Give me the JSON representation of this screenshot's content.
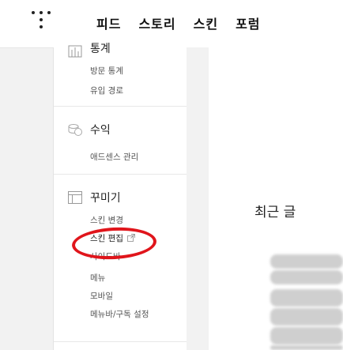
{
  "header": {
    "logo_icon": "tistory-dots-logo-icon",
    "nav": [
      "피드",
      "스토리",
      "스킨",
      "포럼"
    ]
  },
  "sidebar": {
    "stats_section": {
      "title": "통계",
      "icon": "chart-icon",
      "items": [
        "방문 통계",
        "유입 경로"
      ]
    },
    "revenue_section": {
      "title": "수익",
      "icon": "coins-icon",
      "items": [
        "애드센스 관리"
      ]
    },
    "decorate_section": {
      "title": "꾸미기",
      "icon": "layout-icon",
      "items": [
        "스킨 변경",
        "스킨 편집",
        "사이드바",
        "메뉴",
        "모바일",
        "메뉴바/구독 설정"
      ],
      "skin_edit_external_icon": "external-link-icon"
    }
  },
  "main": {
    "recent_posts_heading": "최근 글"
  },
  "annotation": {
    "highlight_color": "#e0151b",
    "highlighted_item": "스킨 편집"
  }
}
